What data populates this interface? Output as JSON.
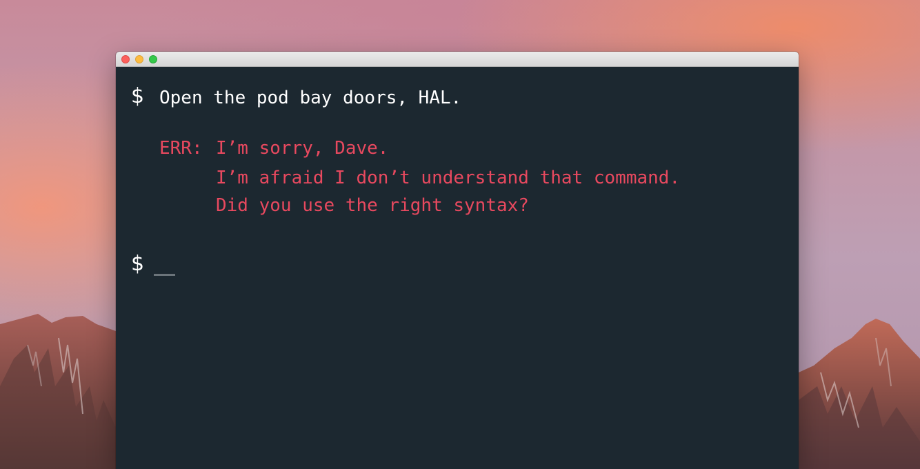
{
  "window": {
    "traffic_lights": [
      "close",
      "minimize",
      "maximize"
    ]
  },
  "terminal": {
    "prompt_symbol": "$",
    "command": "Open the pod bay doors, HAL.",
    "error_prefix": "ERR:",
    "error_lines": [
      "I’m sorry, Dave.",
      "I’m afraid I don’t understand that command.",
      "Did you use the right syntax?"
    ],
    "second_prompt_symbol": "$"
  },
  "colors": {
    "terminal_bg": "#1c2830",
    "text": "#ffffff",
    "error": "#e8495f",
    "cursor": "#6b747a"
  }
}
